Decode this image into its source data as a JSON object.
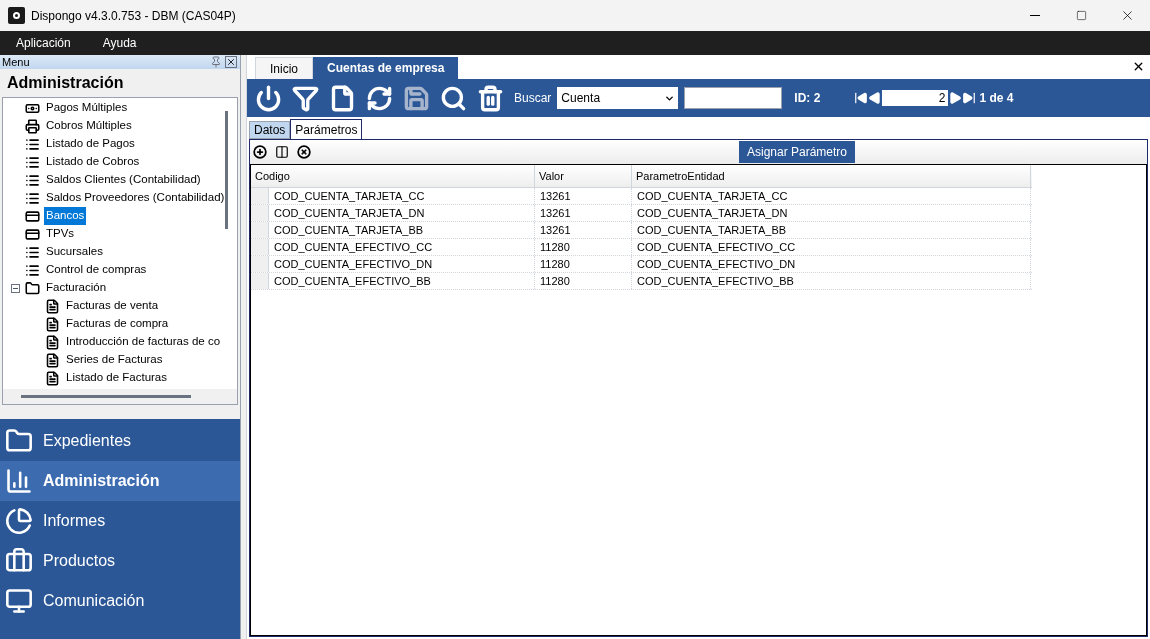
{
  "window": {
    "title": "Dispongo v4.3.0.753 - DBM (CAS04P)"
  },
  "menu_bar": [
    "Aplicación",
    "Ayuda"
  ],
  "side_panel": {
    "header": "Menu",
    "title": "Administración",
    "tree": [
      {
        "label": "Pagos Múltiples",
        "kind": "payments",
        "selected": false
      },
      {
        "label": "Cobros Múltiples",
        "kind": "receipts",
        "selected": false
      },
      {
        "label": "Listado de Pagos",
        "kind": "list",
        "selected": false
      },
      {
        "label": "Listado de Cobros",
        "kind": "list",
        "selected": false
      },
      {
        "label": "Saldos Clientes (Contabilidad)",
        "kind": "list",
        "selected": false
      },
      {
        "label": "Saldos Proveedores (Contabilidad)",
        "kind": "list",
        "selected": false
      },
      {
        "label": "Bancos",
        "kind": "card",
        "selected": true
      },
      {
        "label": "TPVs",
        "kind": "card",
        "selected": false
      },
      {
        "label": "Sucursales",
        "kind": "list",
        "selected": false
      },
      {
        "label": "Control de compras",
        "kind": "list",
        "selected": false
      },
      {
        "label": "Facturación",
        "kind": "folder",
        "selected": false,
        "expanded": true,
        "children": [
          {
            "label": "Facturas de venta",
            "kind": "invoice",
            "selected": false
          },
          {
            "label": "Facturas de compra",
            "kind": "invoice",
            "selected": false
          },
          {
            "label": "Introducción de facturas de co",
            "kind": "invoice",
            "selected": false
          },
          {
            "label": "Series de Facturas",
            "kind": "invoice",
            "selected": false
          },
          {
            "label": "Listado de Facturas",
            "kind": "invoice",
            "selected": false
          }
        ]
      }
    ],
    "nav": [
      {
        "label": "Expedientes",
        "kind": "folder",
        "selected": false
      },
      {
        "label": "Administración",
        "kind": "chart",
        "selected": true
      },
      {
        "label": "Informes",
        "kind": "pie",
        "selected": false
      },
      {
        "label": "Productos",
        "kind": "briefcase",
        "selected": false
      },
      {
        "label": "Comunicación",
        "kind": "monitor",
        "selected": false
      }
    ]
  },
  "tabs": [
    {
      "label": "Inicio",
      "selected": false
    },
    {
      "label": "Cuentas de empresa",
      "selected": true
    }
  ],
  "toolbar": {
    "buttons": [
      {
        "kind": "power",
        "disabled": false
      },
      {
        "kind": "filter",
        "disabled": false
      },
      {
        "kind": "new",
        "disabled": false
      },
      {
        "kind": "refresh",
        "disabled": false
      },
      {
        "kind": "save",
        "disabled": true
      },
      {
        "kind": "search",
        "disabled": false
      },
      {
        "kind": "delete",
        "disabled": false
      }
    ],
    "search_label": "Buscar",
    "search_field": "Cuenta",
    "id_label": "ID: 2",
    "record": "2",
    "record_count": "1 de 4"
  },
  "sub_tabs": [
    {
      "label": "Datos",
      "selected": false
    },
    {
      "label": "Parámetros",
      "selected": true
    }
  ],
  "grid_toolbar": {
    "assign_button": "Asignar Parámetro"
  },
  "table": {
    "columns": [
      "Codigo",
      "Valor",
      "ParametroEntidad"
    ],
    "rows": [
      [
        "COD_CUENTA_TARJETA_CC",
        "13261",
        "COD_CUENTA_TARJETA_CC"
      ],
      [
        "COD_CUENTA_TARJETA_DN",
        "13261",
        "COD_CUENTA_TARJETA_DN"
      ],
      [
        "COD_CUENTA_TARJETA_BB",
        "13261",
        "COD_CUENTA_TARJETA_BB"
      ],
      [
        "COD_CUENTA_EFECTIVO_CC",
        "11280",
        "COD_CUENTA_EFECTIVO_CC"
      ],
      [
        "COD_CUENTA_EFECTIVO_DN",
        "11280",
        "COD_CUENTA_EFECTIVO_DN"
      ],
      [
        "COD_CUENTA_EFECTIVO_BB",
        "11280",
        "COD_CUENTA_EFECTIVO_BB"
      ]
    ]
  }
}
